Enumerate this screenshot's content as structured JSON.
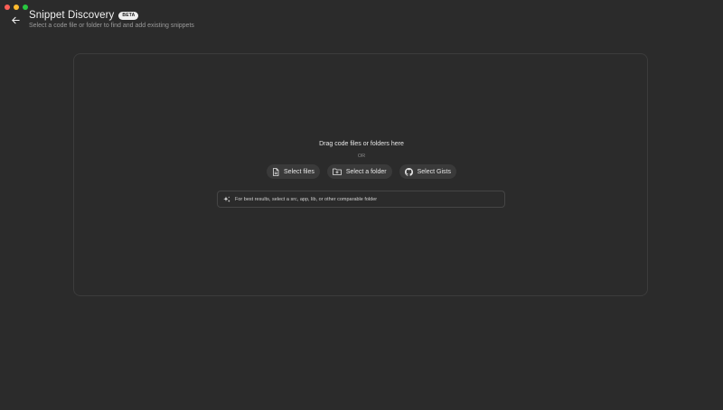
{
  "window": {
    "controls": {
      "close_color": "#ff5f57",
      "minimize_color": "#febc2e",
      "zoom_color": "#28c840"
    }
  },
  "header": {
    "back_icon": "arrow-left-icon",
    "title": "Snippet Discovery",
    "badge": "BETA",
    "subtitle": "Select a code file or folder to find and add existing snippets"
  },
  "dropzone": {
    "drag_text": "Drag code files or folders here",
    "or_text": "OR",
    "buttons": [
      {
        "label": "Select files",
        "icon": "file-icon"
      },
      {
        "label": "Select a folder",
        "icon": "folder-icon"
      },
      {
        "label": "Select Gists",
        "icon": "github-icon"
      }
    ],
    "tip": {
      "icon": "sparkle-icon",
      "text": "For best results, select a src, app, lib, or other comparable folder"
    }
  }
}
